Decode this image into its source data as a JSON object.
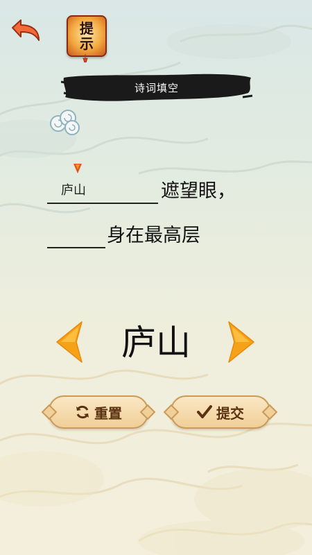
{
  "header": {
    "hint_line1": "提",
    "hint_line2": "示"
  },
  "title": "诗词填空",
  "poem": {
    "line1_filled": "庐山",
    "line1_text": "遮望眼，",
    "line2_text": "身在最高层"
  },
  "selector": {
    "current_option": "庐山"
  },
  "actions": {
    "reset_label": "重置",
    "submit_label": "提交"
  },
  "colors": {
    "accent_orange": "#f5a219",
    "banner_ink": "#1a1a1a",
    "button_text": "#5a3212"
  }
}
